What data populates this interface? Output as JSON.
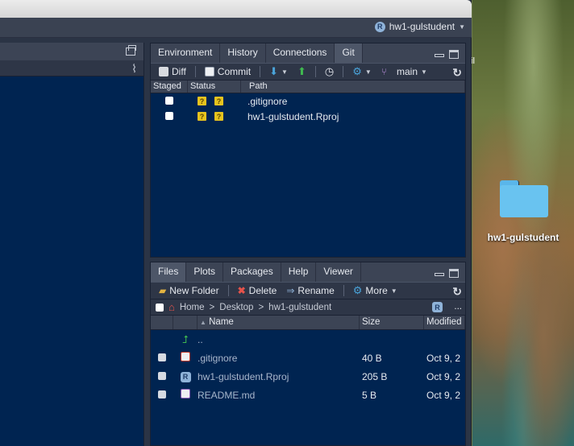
{
  "desktop": {
    "folder_label": "hw1-gulstudent",
    "stray_text": "il"
  },
  "toolbar": {
    "project_label": "hw1-gulstudent",
    "project_icon": "R"
  },
  "git_pane": {
    "tabs": [
      "Environment",
      "History",
      "Connections",
      "Git"
    ],
    "active_tab": "Git",
    "tools": {
      "diff": "Diff",
      "commit": "Commit",
      "branch": "main"
    },
    "columns": {
      "staged": "Staged",
      "status": "Status",
      "path": "Path"
    },
    "rows": [
      {
        "path": ".gitignore",
        "status": [
          "?",
          "?"
        ]
      },
      {
        "path": "hw1-gulstudent.Rproj",
        "status": [
          "?",
          "?"
        ]
      }
    ]
  },
  "files_pane": {
    "tabs": [
      "Files",
      "Plots",
      "Packages",
      "Help",
      "Viewer"
    ],
    "active_tab": "Files",
    "tools": {
      "new_folder": "New Folder",
      "delete": "Delete",
      "rename": "Rename",
      "more": "More"
    },
    "breadcrumbs": [
      "Home",
      "Desktop",
      "hw1-gulstudent"
    ],
    "crumb_sep": ">",
    "ellipsis": "...",
    "columns": {
      "name": "Name",
      "size": "Size",
      "modified": "Modified"
    },
    "parent": "..",
    "rows": [
      {
        "name": ".gitignore",
        "size": "40 B",
        "modified": "Oct 9, 2"
      },
      {
        "name": "hw1-gulstudent.Rproj",
        "size": "205 B",
        "modified": "Oct 9, 2"
      },
      {
        "name": "README.md",
        "size": "5 B",
        "modified": "Oct 9, 2"
      }
    ]
  },
  "colors": {
    "pane_bg": "#002451",
    "chrome": "#3c4455",
    "accent_folder": "#69c3f0"
  }
}
